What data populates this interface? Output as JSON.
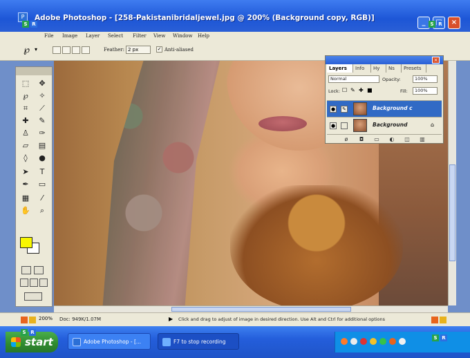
{
  "window": {
    "title": "Adobe Photoshop - [258-Pakistanibridaljewel.jpg @ 200% (Background copy, RGB)]",
    "min_label": "_",
    "max_label": "□",
    "close_label": "×"
  },
  "menu": {
    "items": [
      "File",
      "Image",
      "Layer",
      "Select",
      "Filter",
      "View",
      "Window",
      "Help"
    ]
  },
  "options_bar": {
    "feather_label": "Feather:",
    "feather_value": "2 px",
    "antialias_label": "Anti-aliased"
  },
  "layers_panel": {
    "tabs": [
      "Layers",
      "Info",
      "Hy",
      "Ns",
      "Presets"
    ],
    "blend_mode": "Normal",
    "opacity_label": "Opacity:",
    "opacity_value": "100%",
    "lock_label": "Lock:",
    "fill_label": "Fill:",
    "fill_value": "100%",
    "layers": [
      {
        "name": "Background c",
        "selected": true
      },
      {
        "name": "Background",
        "selected": false
      }
    ]
  },
  "status": {
    "zoom": "200%",
    "doc": "Doc: 949K/1.07M",
    "hint": "Click and drag to adjust of image in desired direction. Use Alt and Ctrl for additional options"
  },
  "taskbar": {
    "start_label": "start",
    "tasks": [
      {
        "label": "Adobe Photoshop - [...",
        "active": true
      },
      {
        "label": "F7 to stop recording",
        "active": false
      }
    ]
  },
  "colors": {
    "foreground": "#f7f700",
    "background": "#ffffff",
    "selection": "#316ac5",
    "titlebar": "#2a5fd6"
  }
}
